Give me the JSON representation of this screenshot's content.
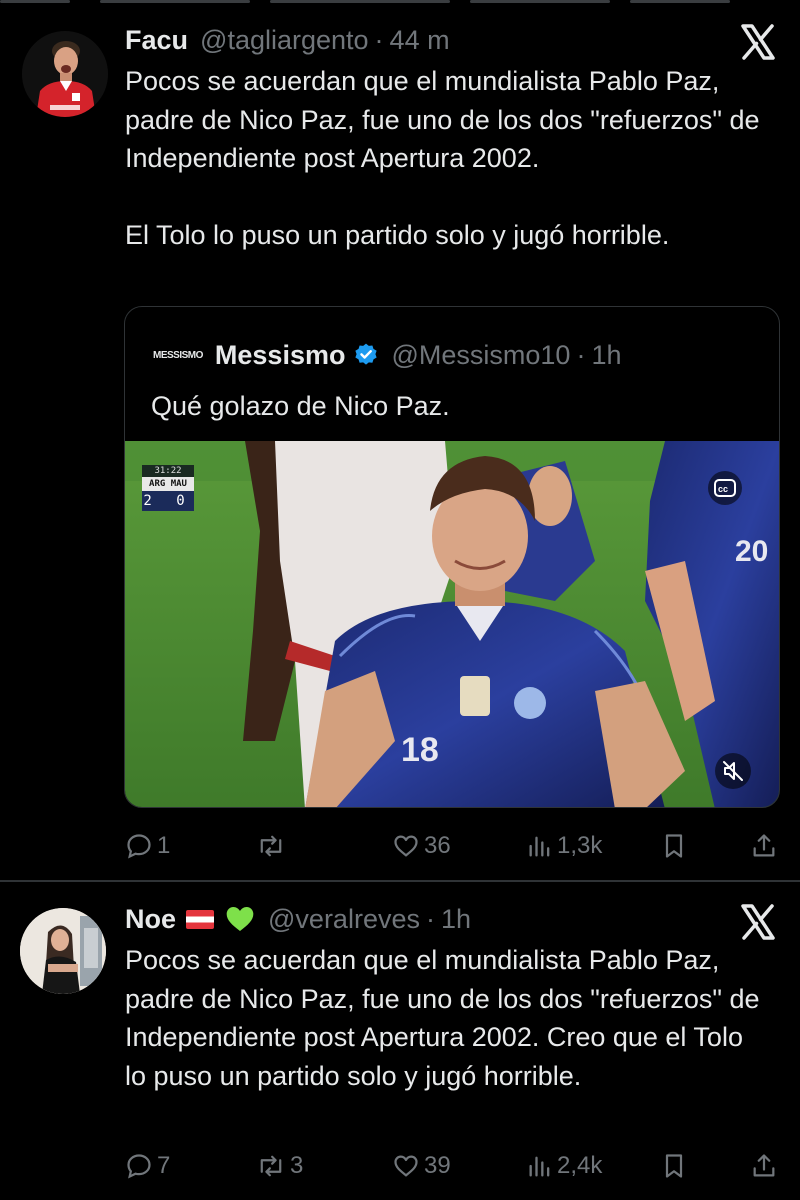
{
  "tweets": [
    {
      "name": "Facu",
      "handle": "@tagliargento",
      "time": "44 m",
      "text": "Pocos se acuerdan que el mundialista Pablo Paz, padre de Nico Paz, fue uno de los dos \"refuerzos\" de Independiente post Apertura 2002.\n\nEl Tolo lo puso un partido solo y jugó horrible.",
      "quote": {
        "logo_text": "MESSISMO",
        "name": "Messismo",
        "handle": "@Messismo10",
        "time": "1h",
        "text": "Qué golazo de Nico Paz.",
        "scoreboard": {
          "time": "31:22",
          "teams": "ARG MAU",
          "score": "2 0"
        },
        "jersey_number": "18",
        "jersey_number_bg": "20"
      },
      "stats": {
        "replies": "1",
        "reposts": "",
        "likes": "36",
        "views": "1,3k"
      }
    },
    {
      "name": "Noe",
      "handle": "@veralreves",
      "time": "1h",
      "text": "Pocos se acuerdan que el mundialista Pablo Paz, padre de Nico Paz, fue uno de los dos \"refuerzos\" de Independiente post Apertura 2002. Creo que el Tolo lo puso un partido solo y jugó horrible.",
      "stats": {
        "replies": "7",
        "reposts": "3",
        "likes": "39",
        "views": "2,4k"
      }
    }
  ],
  "colors": {
    "background": "#000000",
    "text": "#e7e9ea",
    "muted": "#71767b",
    "verified": "#1d9bf0",
    "divider": "#2f3336",
    "heart_emoji": "#7ee04a"
  },
  "icons": [
    "x-logo-icon",
    "verified-badge-icon",
    "reply-icon",
    "repost-icon",
    "like-icon",
    "views-icon",
    "bookmark-icon",
    "share-icon",
    "closed-captions-icon",
    "mute-icon",
    "green-heart-emoji",
    "latvia-flag-emoji"
  ]
}
